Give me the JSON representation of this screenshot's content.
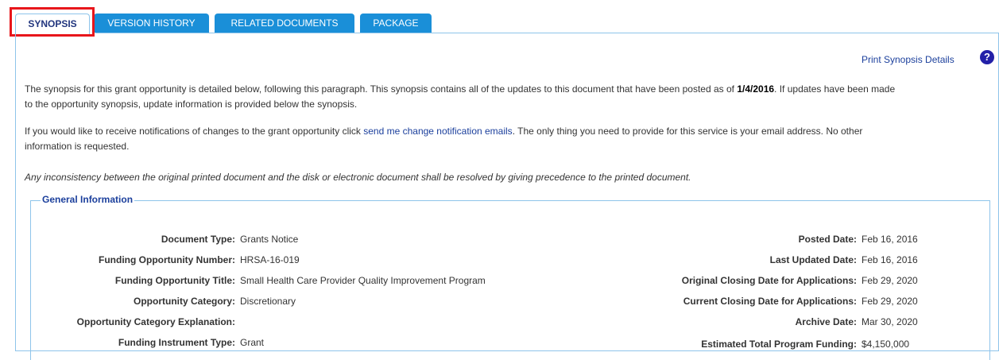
{
  "tabs": [
    {
      "label": "SYNOPSIS"
    },
    {
      "label": "VERSION HISTORY"
    },
    {
      "label": "RELATED DOCUMENTS"
    },
    {
      "label": "PACKAGE"
    }
  ],
  "print_link": "Print Synopsis Details",
  "help_glyph": "?",
  "intro": {
    "part1": "The synopsis for this grant opportunity is detailed below, following this paragraph. This synopsis contains all of the updates to this document that have been posted as of ",
    "date": "1/4/2016",
    "part2": ". If updates have been made",
    "line2": "to the opportunity synopsis, update information is provided below the synopsis."
  },
  "notify": {
    "part1": "If you would like to receive notifications of changes to the grant opportunity click ",
    "link": "send me change notification emails",
    "part2": ". The only thing you need to provide for this service is your email address. No other",
    "line2": "information is requested."
  },
  "disclaimer": "Any inconsistency between the original printed document and the disk or electronic document shall be resolved by giving precedence to the printed document.",
  "general_info": {
    "legend": "General Information",
    "left": [
      {
        "label": "Document Type:",
        "value": "Grants Notice"
      },
      {
        "label": "Funding Opportunity Number:",
        "value": "HRSA-16-019"
      },
      {
        "label": "Funding Opportunity Title:",
        "value": "Small Health Care Provider Quality Improvement Program"
      },
      {
        "label": "Opportunity Category:",
        "value": "Discretionary"
      },
      {
        "label": "Opportunity Category Explanation:",
        "value": ""
      },
      {
        "label": "Funding Instrument Type:",
        "value": "Grant"
      }
    ],
    "right": [
      {
        "label": "Posted Date:",
        "value": "Feb 16, 2016"
      },
      {
        "label": "Last Updated Date:",
        "value": "Feb 16, 2016"
      },
      {
        "label": "Original Closing Date for Applications:",
        "value": "Feb 29, 2020"
      },
      {
        "label": "Current Closing Date for Applications:",
        "value": "Feb 29, 2020"
      },
      {
        "label": "Archive Date:",
        "value": "Mar 30, 2020"
      },
      {
        "label": "Estimated Total Program Funding:",
        "value": "$4,150,000"
      }
    ]
  }
}
